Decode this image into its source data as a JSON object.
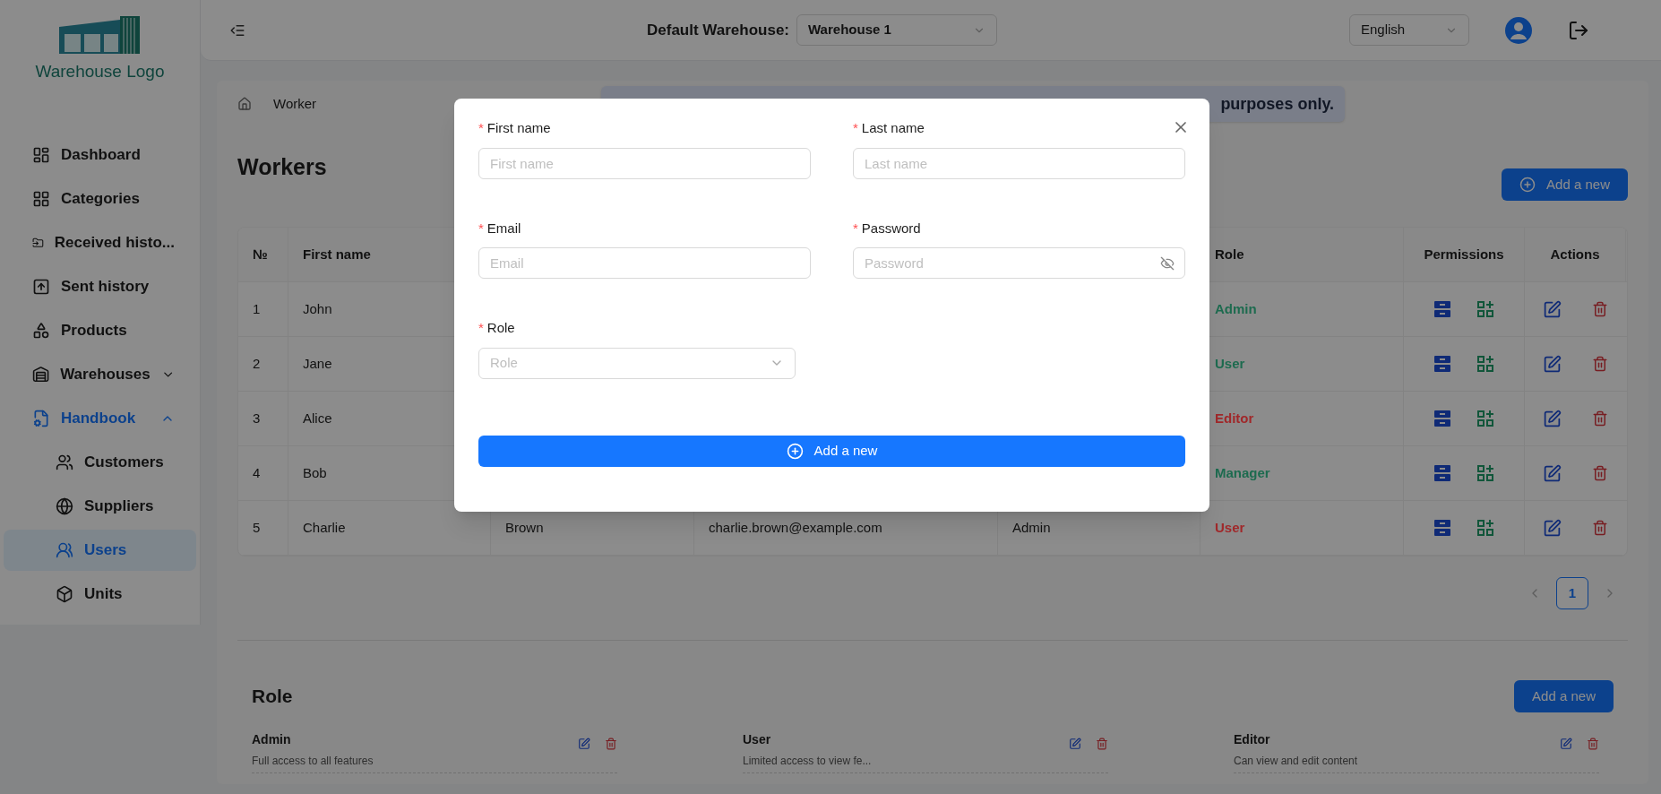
{
  "logo": {
    "text": "Warehouse Logo"
  },
  "sidebar": {
    "items": [
      {
        "label": "Dashboard",
        "selected": false
      },
      {
        "label": "Categories",
        "selected": false
      },
      {
        "label": "Received histo...",
        "selected": false
      },
      {
        "label": "Sent history",
        "selected": false
      },
      {
        "label": "Products",
        "selected": false
      },
      {
        "label": "Warehouses",
        "selected": false,
        "expanded": false
      },
      {
        "label": "Handbook",
        "selected": false,
        "expanded": true,
        "children": [
          {
            "label": "Customers",
            "selected": false
          },
          {
            "label": "Suppliers",
            "selected": false
          },
          {
            "label": "Users",
            "selected": true
          },
          {
            "label": "Units",
            "selected": false
          }
        ]
      }
    ]
  },
  "header": {
    "warehouse_label": "Default Warehouse:",
    "warehouse_value": "Warehouse 1",
    "language": "English"
  },
  "breadcrumb": [
    "Worker"
  ],
  "banner": {
    "text": "purposes only."
  },
  "page_title": "Workers",
  "add_button": "Add a new",
  "table": {
    "columns": [
      "№",
      "First name",
      "Role",
      "Permissions",
      "Actions"
    ],
    "rows": [
      {
        "cells": [
          "1",
          "John"
        ],
        "role": "Admin",
        "color": "#1d6b4f"
      },
      {
        "cells": [
          "2",
          "Jane"
        ],
        "role": "User",
        "color": "#1d6b4f"
      },
      {
        "cells": [
          "3",
          "Alice"
        ],
        "role": "Editor",
        "color": "#a0282a"
      },
      {
        "cells": [
          "4",
          "Bob"
        ],
        "role": "Manager",
        "color": "#1d6b4f"
      },
      {
        "cells": [
          "5",
          "Charlie",
          "Brown",
          "charlie.brown@example.com",
          "Admin"
        ],
        "role": "User",
        "color": "#a0282a"
      }
    ]
  },
  "pagination": {
    "pages": [
      {
        "label": "1",
        "selected": true
      }
    ]
  },
  "roles": {
    "title": "Role",
    "add_button": "Add a new",
    "items": [
      {
        "name": "Admin",
        "description": "Full access to all features"
      },
      {
        "name": "User",
        "description": "Limited access to view fe..."
      },
      {
        "name": "Editor",
        "description": "Can view and edit content"
      }
    ]
  },
  "modal": {
    "fields": [
      {
        "kind": "text",
        "label": "First name",
        "required_mark": "*",
        "placeholder": "First name"
      },
      {
        "kind": "text",
        "label": "Last name",
        "required_mark": "*",
        "placeholder": "Last name"
      },
      {
        "kind": "text",
        "label": "Email",
        "required_mark": "*",
        "placeholder": "Email"
      },
      {
        "kind": "password",
        "label": "Password",
        "required_mark": "*",
        "placeholder": "Password"
      },
      {
        "kind": "select",
        "label": "Role",
        "required_mark": "*",
        "placeholder": "Role"
      }
    ],
    "submit": "Add a new"
  }
}
